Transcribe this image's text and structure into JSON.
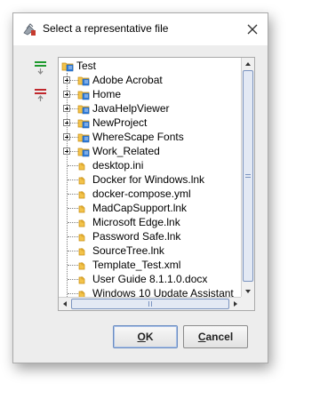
{
  "dialog": {
    "title": "Select a representative file",
    "ok_mnemonic": "O",
    "ok_rest": "K",
    "cancel_mnemonic": "C",
    "cancel_rest": "ancel"
  },
  "tree": {
    "root": "Test",
    "folders": [
      "Adobe Acrobat",
      "Home",
      "JavaHelpViewer",
      "NewProject",
      "WhereScape Fonts",
      "Work_Related"
    ],
    "files": [
      "desktop.ini",
      "Docker for Windows.lnk",
      "docker-compose.yml",
      "MadCapSupport.lnk",
      "Microsoft Edge.lnk",
      "Password Safe.lnk",
      "SourceTree.lnk",
      "Template_Test.xml",
      "User Guide 8.1.1.0.docx",
      "Windows 10 Update Assistant"
    ]
  },
  "colors": {
    "add_button": "#1e9a2e",
    "remove_button": "#c0282d",
    "folder": "#f3c34a",
    "folder_badge": "#2f7bd8",
    "scroll_thumb": "#e3e9f4"
  },
  "icons": {
    "title": "file-chooser-icon",
    "close": "close-icon",
    "add": "add-green-lines-icon",
    "remove": "remove-red-lines-icon",
    "folder": "folder-icon",
    "file": "file-icon"
  }
}
